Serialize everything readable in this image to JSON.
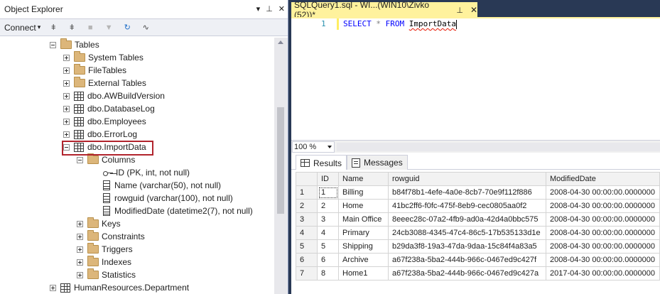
{
  "object_explorer": {
    "title": "Object Explorer",
    "pin_glyph": "▾ ⭧ ✕",
    "connect_label": "Connect",
    "tree": [
      {
        "label": "Tables",
        "indent": 0,
        "icon": "folder",
        "expander": "minus"
      },
      {
        "label": "System Tables",
        "indent": 1,
        "icon": "folder",
        "expander": "plus"
      },
      {
        "label": "FileTables",
        "indent": 1,
        "icon": "folder",
        "expander": "plus"
      },
      {
        "label": "External Tables",
        "indent": 1,
        "icon": "folder",
        "expander": "plus"
      },
      {
        "label": "dbo.AWBuildVersion",
        "indent": 1,
        "icon": "table",
        "expander": "plus"
      },
      {
        "label": "dbo.DatabaseLog",
        "indent": 1,
        "icon": "table",
        "expander": "plus"
      },
      {
        "label": "dbo.Employees",
        "indent": 1,
        "icon": "table",
        "expander": "plus"
      },
      {
        "label": "dbo.ErrorLog",
        "indent": 1,
        "icon": "table",
        "expander": "plus"
      },
      {
        "label": "dbo.ImportData",
        "indent": 1,
        "icon": "table",
        "expander": "minus",
        "highlighted": true
      },
      {
        "label": "Columns",
        "indent": 2,
        "icon": "folder",
        "expander": "minus"
      },
      {
        "label": "ID (PK, int, not null)",
        "indent": 3,
        "icon": "key",
        "expander": "none"
      },
      {
        "label": "Name (varchar(50), not null)",
        "indent": 3,
        "icon": "column",
        "expander": "none"
      },
      {
        "label": "rowguid (varchar(100), not null)",
        "indent": 3,
        "icon": "column",
        "expander": "none"
      },
      {
        "label": "ModifiedDate (datetime2(7), not null)",
        "indent": 3,
        "icon": "column",
        "expander": "none"
      },
      {
        "label": "Keys",
        "indent": 2,
        "icon": "folder",
        "expander": "plus"
      },
      {
        "label": "Constraints",
        "indent": 2,
        "icon": "folder",
        "expander": "plus"
      },
      {
        "label": "Triggers",
        "indent": 2,
        "icon": "folder",
        "expander": "plus"
      },
      {
        "label": "Indexes",
        "indent": 2,
        "icon": "folder",
        "expander": "plus"
      },
      {
        "label": "Statistics",
        "indent": 2,
        "icon": "folder",
        "expander": "plus"
      },
      {
        "label": "HumanResources.Department",
        "indent": 0,
        "icon": "table",
        "expander": "plus"
      }
    ]
  },
  "query": {
    "tab_title": "SQLQuery1.sql - WI...(WIN10\\Zivko (52))*",
    "line_number": "1",
    "code": {
      "kw1": "SELECT",
      "star": "*",
      "kw2": "FROM",
      "ident": "ImportData"
    },
    "zoom": "100 %"
  },
  "results": {
    "tabs": [
      "Results",
      "Messages"
    ],
    "columns": [
      "ID",
      "Name",
      "rowguid",
      "ModifiedDate"
    ],
    "rows": [
      [
        "1",
        "1",
        "Billing",
        "b84f78b1-4efe-4a0e-8cb7-70e9f112f886",
        "2008-04-30 00:00:00.0000000"
      ],
      [
        "2",
        "2",
        "Home",
        "41bc2ff6-f0fc-475f-8eb9-cec0805aa0f2",
        "2008-04-30 00:00:00.0000000"
      ],
      [
        "3",
        "3",
        "Main Office",
        "8eeec28c-07a2-4fb9-ad0a-42d4a0bbc575",
        "2008-04-30 00:00:00.0000000"
      ],
      [
        "4",
        "4",
        "Primary",
        "24cb3088-4345-47c4-86c5-17b535133d1e",
        "2008-04-30 00:00:00.0000000"
      ],
      [
        "5",
        "5",
        "Shipping",
        "b29da3f8-19a3-47da-9daa-15c84f4a83a5",
        "2008-04-30 00:00:00.0000000"
      ],
      [
        "6",
        "6",
        "Archive",
        "a67f238a-5ba2-444b-966c-0467ed9c427f",
        "2008-04-30 00:00:00.0000000"
      ],
      [
        "7",
        "8",
        "Home1",
        "a67f238a-5ba2-444b-966c-0467ed9c427a",
        "2017-04-30 00:00:00.0000000"
      ]
    ]
  },
  "colors": {
    "tab_active": "#fff29d",
    "frame": "#293955",
    "highlight_border": "#b1242d",
    "keyword": "#0000ff",
    "line_number": "#2b91af"
  }
}
